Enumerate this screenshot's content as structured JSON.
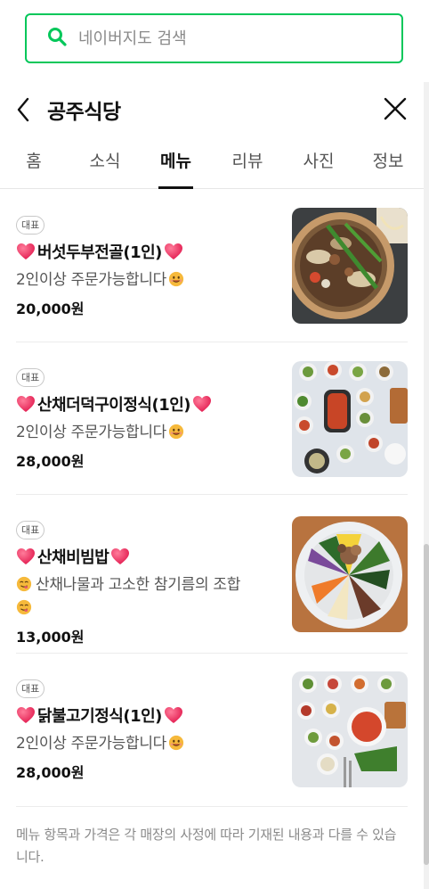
{
  "search": {
    "placeholder": "네이버지도 검색"
  },
  "header": {
    "title": "공주식당"
  },
  "tabs": [
    {
      "label": "홈"
    },
    {
      "label": "소식"
    },
    {
      "label": "메뉴"
    },
    {
      "label": "리뷰"
    },
    {
      "label": "사진"
    },
    {
      "label": "정보"
    }
  ],
  "active_tab": "메뉴",
  "menu": [
    {
      "badge": "대표",
      "name": "버섯두부전골(1인)",
      "desc": "2인이상 주문가능합니다",
      "price": "20,000원",
      "image": "mushroom-tofu-hotpot-photo"
    },
    {
      "badge": "대표",
      "name": "산채더덕구이정식(1인)",
      "desc": "2인이상 주문가능합니다",
      "price": "28,000원",
      "image": "deodeok-set-meal-photo"
    },
    {
      "badge": "대표",
      "name": "산채비빔밥",
      "desc": "산채나물과 고소한 참기름의 조합",
      "price": "13,000원",
      "image": "bibimbap-photo"
    },
    {
      "badge": "대표",
      "name": "닭불고기정식(1인)",
      "desc": "2인이상 주문가능합니다",
      "price": "28,000원",
      "image": "chicken-bulgogi-set-photo"
    }
  ],
  "notice": "메뉴 항목과 가격은 각 매장의 사정에 따라 기재된 내용과 다를 수 있습니다.",
  "colors": {
    "accent": "#03c75a",
    "heart": "#e8285a",
    "text": "#111111",
    "muted": "#8a8a8a"
  },
  "icons": {
    "search": "search-icon",
    "back": "chevron-left-icon",
    "close": "close-icon",
    "heart": "heart-icon",
    "smile": "smile-emoji-icon"
  }
}
